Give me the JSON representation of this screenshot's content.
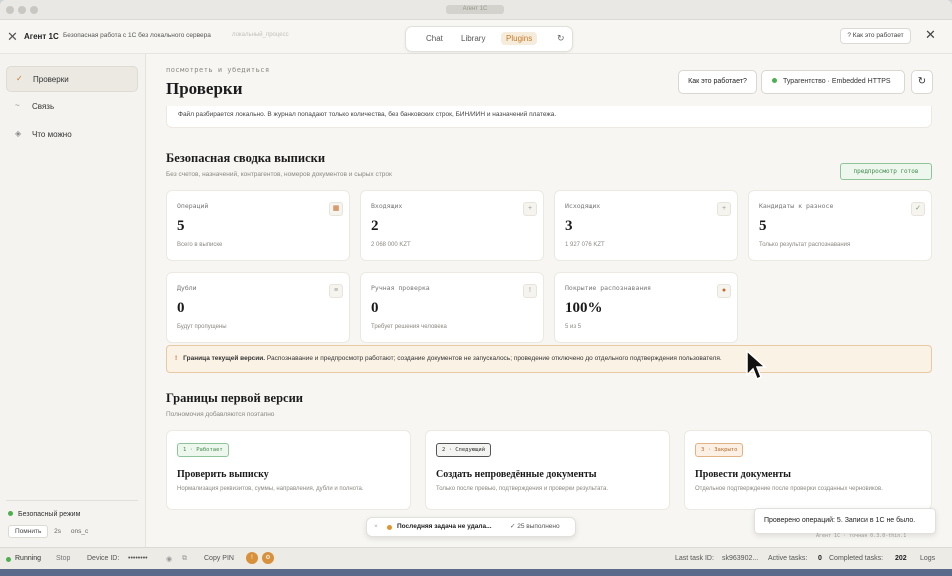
{
  "window": {
    "title": "Агент 1С"
  },
  "header": {
    "app_name": "Агент 1С",
    "subtitle": "Безопасная работа с 1С без локального сервера",
    "hint": "локальный_процесс",
    "tabs": [
      {
        "label": "Chat"
      },
      {
        "label": "Library"
      },
      {
        "label": "Plugins",
        "active": true
      }
    ],
    "refresh_icon": "↻",
    "how_it_works": "? Как это работает",
    "close_icon": "✕"
  },
  "sidebar": {
    "items": [
      {
        "icon": "✓",
        "label": "Проверки",
        "active": true
      },
      {
        "icon": "~",
        "label": "Связь"
      },
      {
        "icon": "◈",
        "label": "Что можно"
      }
    ],
    "safe_mode": "Безопасный режим",
    "remember_label": "Помнить",
    "remember_value": "2s",
    "remember_note": "ons_c"
  },
  "main": {
    "eyebrow": "посмотреть и убедиться",
    "title": "Проверки",
    "how_button": "Как это работает?",
    "connection": "Турагентство · Embedded HTTPS",
    "refresh_icon": "↻",
    "local_note": "Файл разбирается локально. В журнал попадают только количества, без банковских строк, БИН/ИИН и назначений платежа.",
    "summary": {
      "title": "Безопасная сводка выписки",
      "subtitle": "Без счетов, назначений, контрагентов, номеров документов и сырых строк",
      "badge": "предпросмотр готов",
      "cards": [
        {
          "label": "Операций",
          "value": "5",
          "note": "Всего в выписке",
          "icon": "▦",
          "icon_color": "orange"
        },
        {
          "label": "Входящих",
          "value": "2",
          "note": "2 068 000 KZT",
          "icon": "+",
          "icon_color": "gray"
        },
        {
          "label": "Исходящих",
          "value": "3",
          "note": "1 927 076 KZT",
          "icon": "+",
          "icon_color": "gray"
        },
        {
          "label": "Кандидаты к разносе",
          "value": "5",
          "note": "Только результат распознавания",
          "icon": "✓",
          "icon_color": "green"
        },
        {
          "label": "Дубли",
          "value": "0",
          "note": "Будут пропущены",
          "icon": "≡",
          "icon_color": "gray"
        },
        {
          "label": "Ручная проверка",
          "value": "0",
          "note": "Требует решения человека",
          "icon": "!",
          "icon_color": "gray"
        },
        {
          "label": "Покрытие распознавания",
          "value": "100%",
          "note": "5 из 5",
          "icon": "●",
          "icon_color": "orange"
        }
      ]
    },
    "warning": {
      "bold": "Граница текущей версии.",
      "text": "Распознавание и предпросмотр работают; создание документов не запускалось; проведение отключено до отдельного подтверждения пользователя."
    },
    "phases": {
      "title": "Границы первой версии",
      "subtitle": "Полномочия добавляются поэтапно",
      "cards": [
        {
          "badge": "1 · Работает",
          "badge_style": "green",
          "title": "Проверить выписку",
          "desc": "Нормализация реквизитов, суммы, направления, дубли и полнота."
        },
        {
          "badge": "2 · Следующий",
          "badge_style": "dark",
          "title": "Создать непроведённые документы",
          "desc": "Только после превью, подтверждения и проверки результата."
        },
        {
          "badge": "3 · Закрыто",
          "badge_style": "orange",
          "title": "Провести документы",
          "desc": "Отдельное подтверждение после проверки созданных черновиков."
        }
      ]
    }
  },
  "toasts": {
    "task": {
      "message": "Последняя задача не удала...",
      "done": "✓ 25 выполнено"
    },
    "result": "Проверено операций: 5. Записи в 1С не было.",
    "result_sub": "Агент 1С · точная 0.3.0-thin.1"
  },
  "statusbar": {
    "running": "Running",
    "stop": "Stop",
    "device_label": "Device ID:",
    "device_value": "••••••••",
    "copy_pin": "Copy PIN",
    "last_task_label": "Last task ID:",
    "last_task_value": "sk963902...",
    "active_tasks_label": "Active tasks:",
    "active_tasks_value": "0",
    "completed_label": "Completed tasks:",
    "completed_value": "202",
    "logs": "Logs"
  }
}
